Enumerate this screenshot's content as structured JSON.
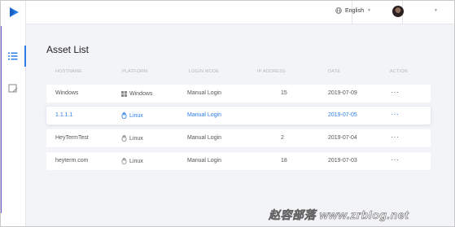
{
  "header": {
    "language": "English"
  },
  "main": {
    "title": "Asset List",
    "columns": [
      "HOSTNAME",
      "PLATFORM",
      "LOGIN MODE",
      "IP ADDRESS",
      "DATE",
      "ACTION"
    ],
    "rows": [
      {
        "hostname": "Windows",
        "platform": "Windows",
        "login_mode": "Manual Login",
        "ip": "15",
        "date": "2019-07-09",
        "action": "···"
      },
      {
        "hostname": "1.1.1.1",
        "platform": "Linux",
        "login_mode": "Manual Login",
        "ip": "",
        "date": "2019-07-05",
        "action": "···"
      },
      {
        "hostname": "HeyTermTest",
        "platform": "Linux",
        "login_mode": "Manual Login",
        "ip": "2",
        "date": "2019-07-04",
        "action": "···"
      },
      {
        "hostname": "heyterm.com",
        "platform": "Linux",
        "login_mode": "Manual Login",
        "ip": "18",
        "date": "2019-07-03",
        "action": "···"
      }
    ]
  },
  "watermark": "赵容部落 www.zrblog.net",
  "colors": {
    "accent": "#2b7de9",
    "rail_accent": "#6d5bd0",
    "logo": "#2b7de9"
  },
  "icons": {
    "logo": "play-logo-icon",
    "nav_list": "list-icon",
    "nav_edit": "edit-icon",
    "windows": "windows-icon",
    "linux": "linux-icon"
  }
}
